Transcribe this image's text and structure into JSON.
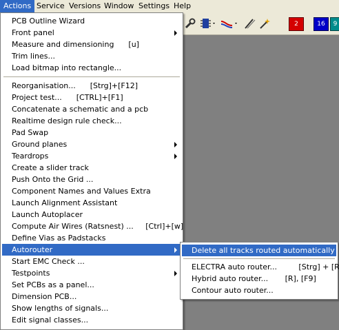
{
  "menubar": {
    "items": [
      "Actions",
      "Service",
      "Versions",
      "Window",
      "Settings",
      "Help"
    ]
  },
  "toolbar": {
    "badges": [
      "2",
      "16",
      "9"
    ],
    "icons": [
      "wrench-icon",
      "component-icon",
      "route-icon",
      "pen-icon",
      "wand-icon"
    ]
  },
  "actions_menu": {
    "group1": [
      {
        "label": "PCB Outline Wizard"
      },
      {
        "label": "Front panel",
        "submenu": true
      },
      {
        "label": "Measure and dimensioning      [u]"
      },
      {
        "label": "Trim lines..."
      },
      {
        "label": "Load bitmap into rectangle..."
      }
    ],
    "group2": [
      {
        "label": "Reorganisation...      [Strg]+[F12]"
      },
      {
        "label": "Project test...      [CTRL]+[F1]"
      },
      {
        "label": "Concatenate a schematic and a pcb"
      },
      {
        "label": "Realtime design rule check..."
      },
      {
        "label": "Pad Swap"
      },
      {
        "label": "Ground planes",
        "submenu": true
      },
      {
        "label": "Teardrops",
        "submenu": true
      },
      {
        "label": "Create a slider track"
      },
      {
        "label": "Push Onto the Grid ..."
      },
      {
        "label": "Component Names and Values Extra"
      },
      {
        "label": "Launch Alignment Assistant"
      },
      {
        "label": "Launch Autoplacer"
      },
      {
        "label": "Compute Air Wires (Ratsnest) ...     [Ctrl]+[w]"
      },
      {
        "label": "Define Vias as Padstacks"
      },
      {
        "label": "Autorouter",
        "submenu": true,
        "highlighted": true
      },
      {
        "label": "Start EMC Check ..."
      },
      {
        "label": "Testpoints",
        "submenu": true
      },
      {
        "label": "Set PCBs as a panel..."
      },
      {
        "label": "Dimension PCB..."
      },
      {
        "label": "Show lengths of signals..."
      },
      {
        "label": "Edit signal classes..."
      }
    ]
  },
  "autorouter_submenu": {
    "highlighted": {
      "label": "Delete all tracks routed automatically"
    },
    "items": [
      {
        "label": "ELECTRA auto router...         [Strg] + [R]"
      },
      {
        "label": "Hybrid auto router...       [R], [F9]"
      },
      {
        "label": "Contour auto router..."
      }
    ]
  }
}
